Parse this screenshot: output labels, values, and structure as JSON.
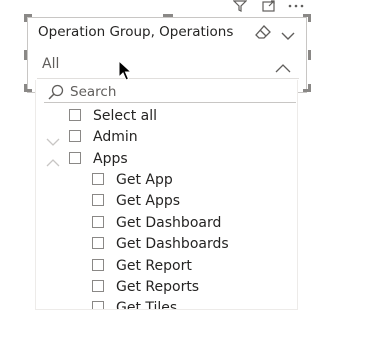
{
  "visual_header": {
    "icons": [
      "filter-icon",
      "focus-mode-icon",
      "more-options-icon"
    ]
  },
  "slicer": {
    "title": "Operation Group, Operations",
    "selected_value": "All",
    "search_placeholder": "Search",
    "items": [
      {
        "label": "Select all",
        "level": 0,
        "expander": null
      },
      {
        "label": "Admin",
        "level": 0,
        "expander": "collapsed"
      },
      {
        "label": "Apps",
        "level": 0,
        "expander": "expanded"
      },
      {
        "label": "Get App",
        "level": 1,
        "expander": null
      },
      {
        "label": "Get Apps",
        "level": 1,
        "expander": null
      },
      {
        "label": "Get Dashboard",
        "level": 1,
        "expander": null
      },
      {
        "label": "Get Dashboards",
        "level": 1,
        "expander": null
      },
      {
        "label": "Get Report",
        "level": 1,
        "expander": null
      },
      {
        "label": "Get Reports",
        "level": 1,
        "expander": null
      },
      {
        "label": "Get Tiles",
        "level": 1,
        "expander": null
      }
    ]
  },
  "colors": {
    "text": "#252423",
    "muted": "#605e5c",
    "border": "#8a8886"
  }
}
